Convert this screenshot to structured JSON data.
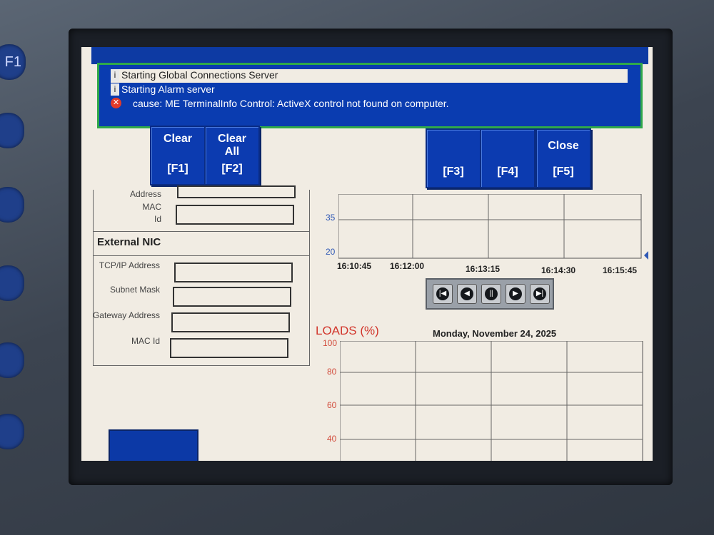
{
  "alarm_banner": {
    "messages": [
      {
        "icon": "info-icon",
        "text": "Starting Global Connections Server"
      },
      {
        "icon": "info-icon",
        "text": "Starting Alarm server"
      },
      {
        "icon": "error-icon",
        "text": "cause: ME TerminalInfo Control: ActiveX control not found on computer."
      }
    ]
  },
  "function_buttons": {
    "clear": {
      "label": "Clear",
      "key": "[F1]"
    },
    "clear_all": {
      "label": "Clear All",
      "key": "[F2]"
    },
    "f3": {
      "key": "[F3]"
    },
    "f4": {
      "key": "[F4]"
    },
    "close": {
      "label": "Close",
      "key": "[F5]"
    }
  },
  "network_panel": {
    "top_labels": [
      "Address",
      "MAC",
      "Id"
    ],
    "external_nic": {
      "title": "External NIC",
      "fields": [
        {
          "label": "TCP/IP Address",
          "value": ""
        },
        {
          "label": "Subnet Mask",
          "value": ""
        },
        {
          "label": "Gateway Address",
          "value": ""
        },
        {
          "label": "MAC Id",
          "value": ""
        }
      ]
    }
  },
  "trend_chart": {
    "y_ticks": [
      "35",
      "20"
    ],
    "x_ticks": [
      "16:10:45",
      "16:12:00",
      "16:13:15",
      "16:14:30",
      "16:15:45"
    ],
    "controls": [
      "first-icon",
      "back-icon",
      "pause-icon",
      "forward-icon",
      "last-icon"
    ]
  },
  "loads_chart": {
    "title": "LOADS (%)",
    "date": "Monday, November 24, 2025",
    "y_ticks": [
      "100",
      "80",
      "60",
      "40"
    ]
  },
  "colors": {
    "button_blue": "#0c3bb0",
    "banner_border": "#2fa84a",
    "load_red": "#d2362c",
    "trend_tick_blue": "#2f58b5",
    "screen_bg": "#f1ece3"
  }
}
